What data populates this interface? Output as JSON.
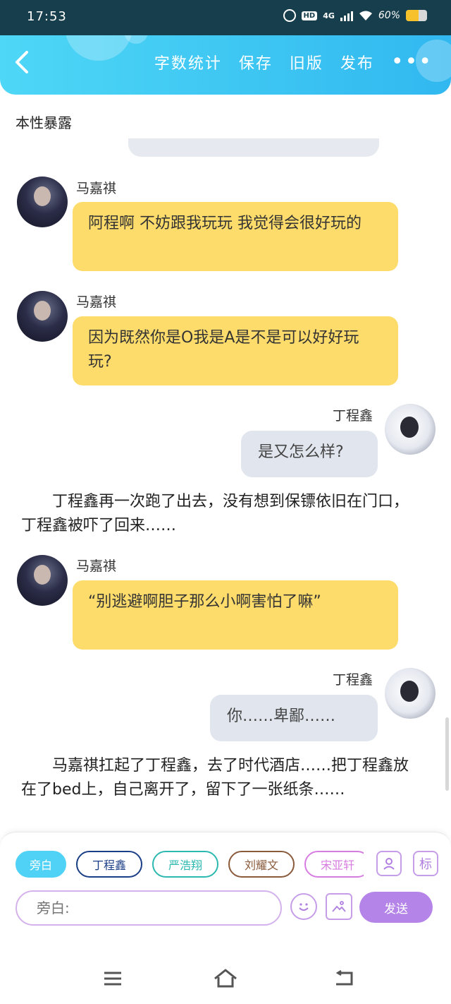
{
  "status_bar": {
    "time": "17:53",
    "hd": "HD",
    "network": "4G",
    "battery_text": "60%",
    "battery_level": 0.6,
    "icons": [
      "alarm-icon",
      "hd-icon",
      "signal-icon",
      "wifi-icon",
      "battery-icon"
    ]
  },
  "header": {
    "back_icon": "chevron-left-icon",
    "nav": {
      "word_count": "字数统计",
      "save": "保存",
      "old_version": "旧版",
      "publish": "发布",
      "more": "•••"
    },
    "colors": {
      "gradient_start": "#4ed7f6",
      "gradient_end": "#31b8f0"
    }
  },
  "story": {
    "title": "本性暴露"
  },
  "messages": [
    {
      "type": "left",
      "name": "马嘉祺",
      "text": "阿程啊 不妨跟我玩玩 我觉得会很好玩的"
    },
    {
      "type": "left",
      "name": "马嘉祺",
      "text": "因为既然你是O我是A是不是可以好好玩玩?"
    },
    {
      "type": "right",
      "name": "丁程鑫",
      "text": "是又怎么样?"
    },
    {
      "type": "narration",
      "text": "丁程鑫再一次跑了出去，没有想到保镖依旧在门口，丁程鑫被吓了回来……"
    },
    {
      "type": "left",
      "name": "马嘉祺",
      "text": "“别逃避啊胆子那么小啊害怕了嘛”"
    },
    {
      "type": "right",
      "name": "丁程鑫",
      "text": "你……卑鄙……"
    },
    {
      "type": "narration",
      "text": "马嘉祺扛起了丁程鑫，去了时代酒店……把丁程鑫放在了bed上，自己离开了，留下了一张纸条……"
    }
  ],
  "composer": {
    "chips": [
      {
        "label": "旁白",
        "color": "#4fd2f5",
        "active": true
      },
      {
        "label": "丁程鑫",
        "color": "#1b3f86",
        "active": false
      },
      {
        "label": "严浩翔",
        "color": "#2db9b0",
        "active": false
      },
      {
        "label": "刘耀文",
        "color": "#8a5a3c",
        "active": false
      },
      {
        "label": "宋亚轩",
        "color": "#d77ce0",
        "active": false
      }
    ],
    "character_icon": "person-card-icon",
    "tag_label": "标",
    "input_placeholder": "旁白:",
    "emoji_icon": "smiley-icon",
    "image_icon": "image-icon",
    "send_label": "发送",
    "accent": "#b584e8"
  },
  "system_nav": {
    "menu": "menu-icon",
    "home": "home-icon",
    "back": "back-arrow-icon"
  }
}
